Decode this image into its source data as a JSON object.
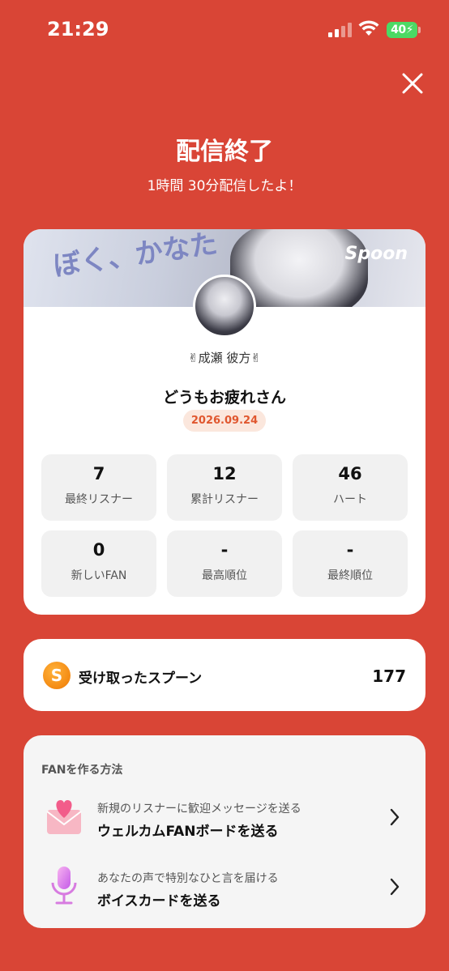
{
  "status_bar": {
    "time": "21:29",
    "battery": "40"
  },
  "header": {
    "title": "配信終了",
    "subtitle": "1時間 30分配信したよ！"
  },
  "profile_card": {
    "banner_logo": "Spoon",
    "banner_text": "ぼく、かなた",
    "user_name": "✌成瀬 彼方✌",
    "live_title": "どうもお疲れさん",
    "date": "2026.09.24"
  },
  "stats": [
    {
      "value": "7",
      "label": "最終リスナー"
    },
    {
      "value": "12",
      "label": "累計リスナー"
    },
    {
      "value": "46",
      "label": "ハート"
    },
    {
      "value": "0",
      "label": "新しいFAN"
    },
    {
      "value": "-",
      "label": "最高順位"
    },
    {
      "value": "-",
      "label": "最終順位"
    }
  ],
  "spoon": {
    "icon_letter": "S",
    "label": "受け取ったスプーン",
    "count": "177"
  },
  "fan_section": {
    "title": "FANを作る方法",
    "items": [
      {
        "icon": "envelope-heart-icon",
        "sub": "新規のリスナーに歓迎メッセージを送る",
        "main": "ウェルカムFANボードを送る"
      },
      {
        "icon": "microphone-icon",
        "sub": "あなたの声で特別なひと言を届ける",
        "main": "ボイスカードを送る"
      }
    ]
  },
  "colors": {
    "background": "#d94536",
    "accent": "#e0572f",
    "date_badge_bg": "#fbe7dd",
    "battery": "#4cd964"
  }
}
